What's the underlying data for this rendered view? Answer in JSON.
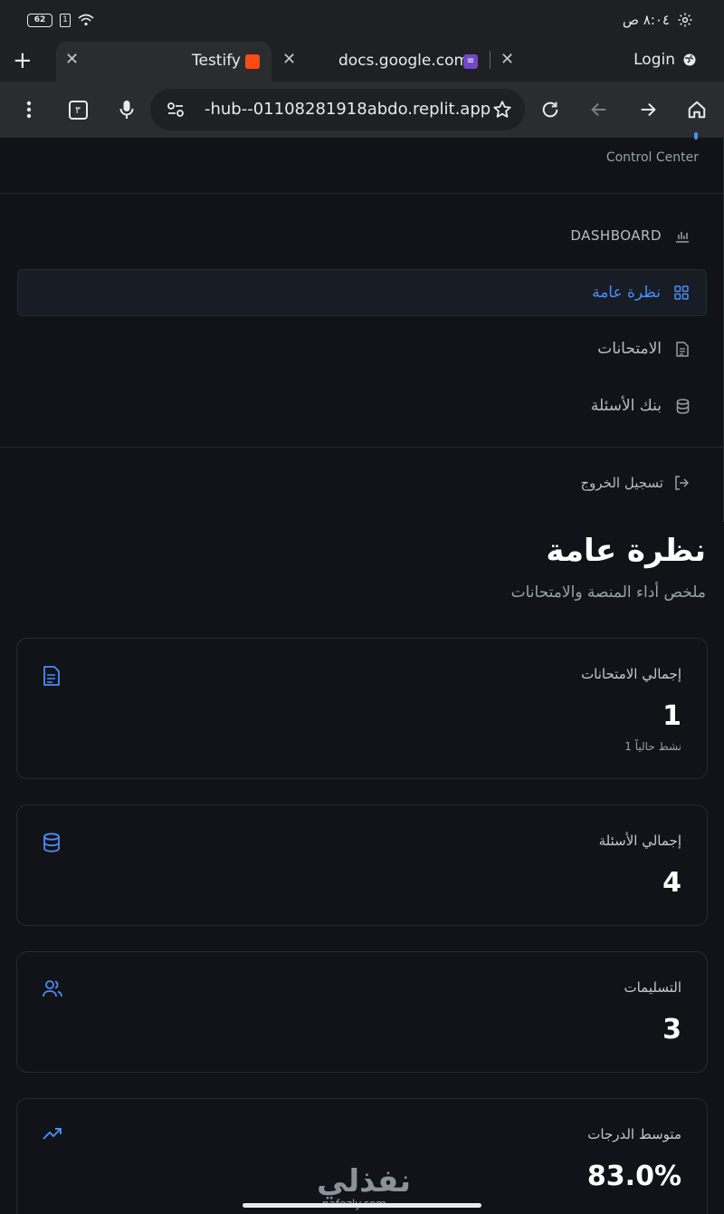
{
  "status_bar": {
    "battery": "62",
    "sim": "1",
    "time": "٨:٠٤ ص"
  },
  "tabs": {
    "active_title": "Testify",
    "second_title": "docs.google.com",
    "login_label": "Login"
  },
  "toolbar": {
    "tab_count": "٣",
    "url": "-hub--01108281918abdo.replit.app"
  },
  "sidebar": {
    "subtitle": "Control Center",
    "items": [
      {
        "label": "DASHBOARD",
        "icon": "bar-chart-icon"
      },
      {
        "label": "نظرة عامة",
        "icon": "grid-icon"
      },
      {
        "label": "الامتحانات",
        "icon": "file-text-icon"
      },
      {
        "label": "بنك الأسئلة",
        "icon": "database-icon"
      }
    ],
    "logout_label": "تسجيل الخروج"
  },
  "main": {
    "title": "نظرة عامة",
    "subtitle": "ملخص أداء المنصة والامتحانات",
    "cards": [
      {
        "label": "إجمالي الامتحانات",
        "value": "1",
        "note": "1 نشط حالياً",
        "icon": "file-text-icon"
      },
      {
        "label": "إجمالي الأسئلة",
        "value": "4",
        "icon": "database-icon"
      },
      {
        "label": "التسليمات",
        "value": "3",
        "icon": "users-icon"
      },
      {
        "label": "متوسط الدرجات",
        "value": "83.0%",
        "icon": "trending-up-icon"
      }
    ]
  },
  "watermark": {
    "text": "نفذلي",
    "sub": "nafezly.com"
  },
  "colors": {
    "accent": "#4b8ef5",
    "background": "#111318"
  }
}
